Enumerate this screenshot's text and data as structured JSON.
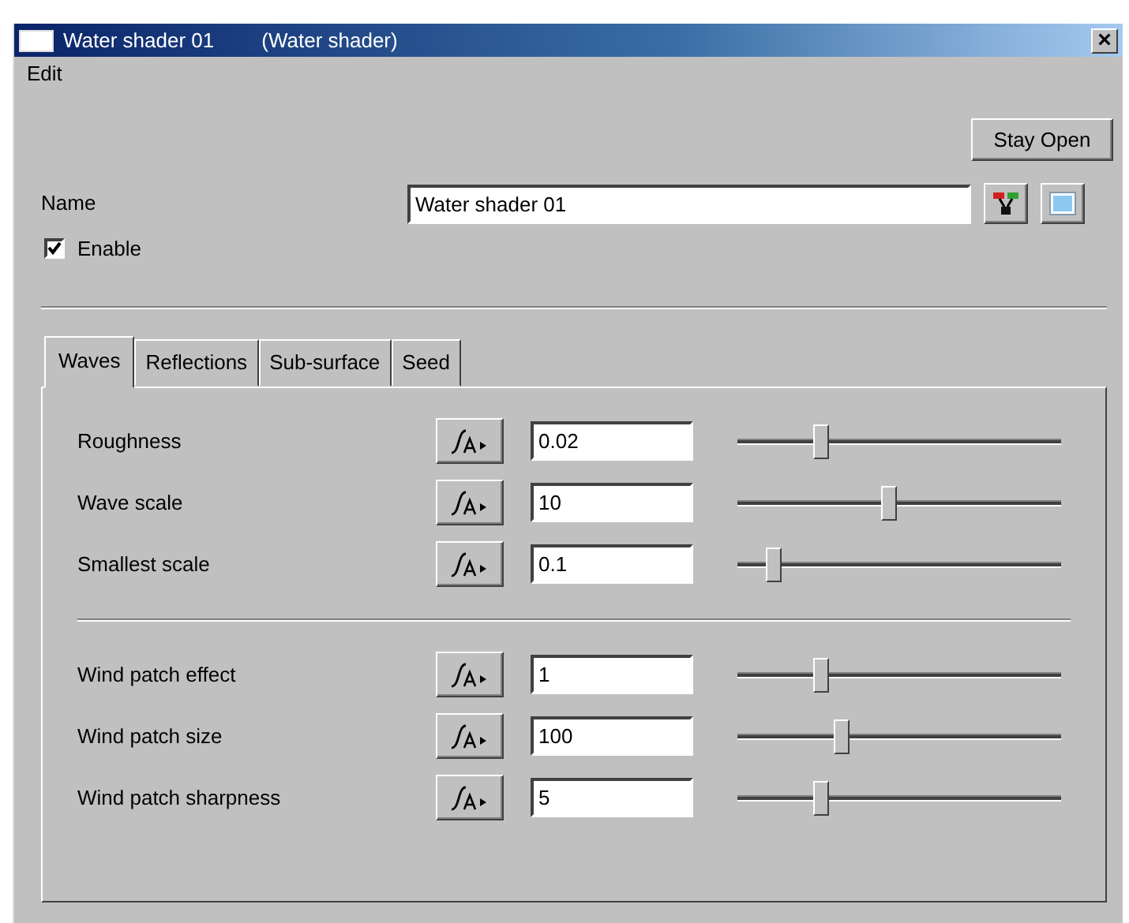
{
  "window": {
    "title": "Water shader 01",
    "subtitle": "(Water shader)",
    "close": "×"
  },
  "menu": [
    {
      "label": "Edit"
    }
  ],
  "stay_open": {
    "label": "Stay Open"
  },
  "name": {
    "label": "Name",
    "value": "Water shader 01"
  },
  "enable": {
    "label": "Enable",
    "checked": true
  },
  "tabs": [
    {
      "label": "Waves",
      "selected": true
    },
    {
      "label": "Reflections",
      "selected": false
    },
    {
      "label": "Sub-surface",
      "selected": false
    },
    {
      "label": "Seed",
      "selected": false
    }
  ],
  "groups": [
    {
      "params": [
        {
          "label": "Roughness",
          "value": "0.02",
          "level": 0.26
        },
        {
          "label": "Wave scale",
          "value": "10",
          "level": 0.47
        },
        {
          "label": "Smallest scale",
          "value": "0.1",
          "level": 0.11
        }
      ]
    },
    {
      "params": [
        {
          "label": "Wind patch effect",
          "value": "1",
          "level": 0.26
        },
        {
          "label": "Wind patch size",
          "value": "100",
          "level": 0.32
        },
        {
          "label": "Wind patch sharpness",
          "value": "5",
          "level": 0.26
        }
      ]
    }
  ]
}
